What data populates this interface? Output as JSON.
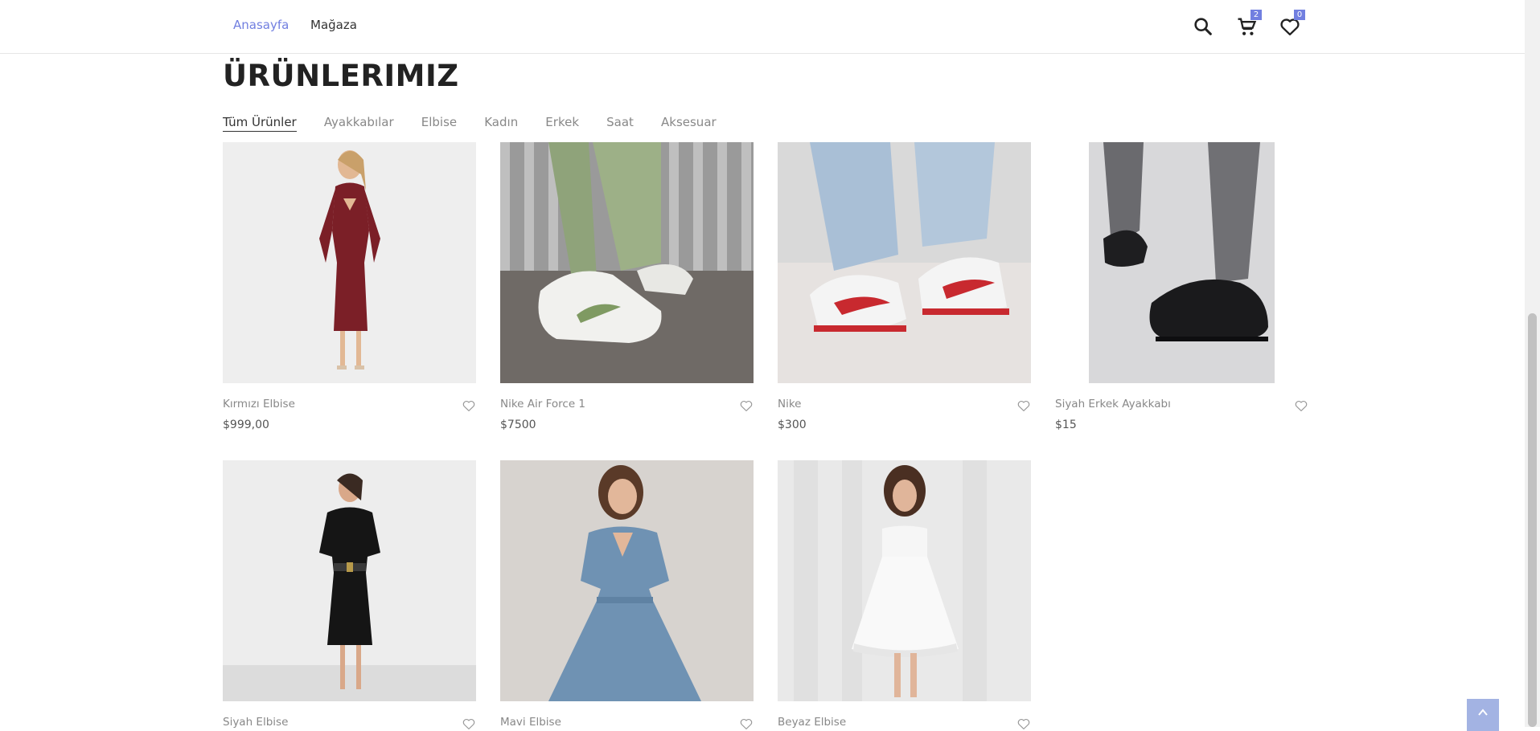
{
  "nav": {
    "home": "Anasayfa",
    "shop": "Mağaza"
  },
  "header_icons": {
    "search_icon": "search-icon",
    "cart_icon": "cart-icon",
    "cart_count": "2",
    "wishlist_icon": "heart-icon",
    "wishlist_count": "0"
  },
  "section": {
    "title": "ÜRÜNLERIMIZ"
  },
  "filters": [
    "Tüm Ürünler",
    "Ayakkabılar",
    "Elbise",
    "Kadın",
    "Erkek",
    "Saat",
    "Aksesuar"
  ],
  "products": [
    {
      "name": "Kırmızı Elbise",
      "price": "$999,00"
    },
    {
      "name": "Nike Air Force 1",
      "price": "$7500"
    },
    {
      "name": "Nike",
      "price": "$300"
    },
    {
      "name": "Siyah Erkek Ayakkabı",
      "price": "$15"
    },
    {
      "name": "Siyah Elbise",
      "price": ""
    },
    {
      "name": "Mavi Elbise",
      "price": ""
    },
    {
      "name": "Beyaz Elbise",
      "price": ""
    }
  ],
  "colors": {
    "accent": "#717fe0",
    "to_top": "#a3b3e3"
  }
}
